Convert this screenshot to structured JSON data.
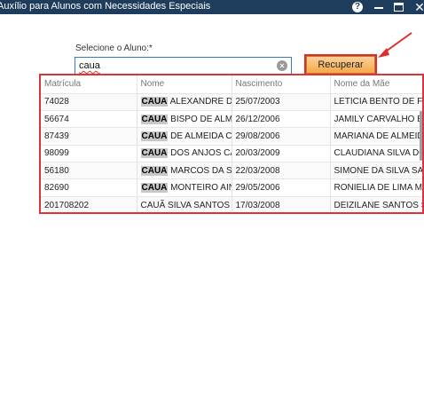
{
  "window": {
    "title": "Auxílio para Alunos com Necessidades Especiais",
    "help_glyph": "?",
    "close_glyph": "✕"
  },
  "form": {
    "label": "Selecione o Aluno:*",
    "search_value": "caua",
    "recover_label": "Recuperar"
  },
  "colors": {
    "titlebar": "#1e3c5c",
    "highlight_border": "#d9353a",
    "button": "#f5a94a"
  },
  "grid": {
    "columns": [
      "Matrícula",
      "Nome",
      "Nascimento",
      "Nome da Mãe"
    ],
    "rows": [
      {
        "matricula": "74028",
        "nome_hl": "CAUA",
        "nome_rest": " ALEXANDRE DE F",
        "nascimento": "25/07/2003",
        "mae": "LETICIA BENTO DE FREI"
      },
      {
        "matricula": "56674",
        "nome_hl": "CAUA",
        "nome_rest": " BISPO DE ALMEID",
        "nascimento": "26/12/2006",
        "mae": "JAMILY CARVALHO BISI"
      },
      {
        "matricula": "87439",
        "nome_hl": "CAUA",
        "nome_rest": " DE ALMEIDA CAF",
        "nascimento": "29/08/2006",
        "mae": "MARIANA DE ALMEIDA"
      },
      {
        "matricula": "98099",
        "nome_hl": "CAUA",
        "nome_rest": " DOS ANJOS CAM",
        "nascimento": "20/03/2009",
        "mae": "CLAUDIANA SILVA DOS"
      },
      {
        "matricula": "56180",
        "nome_hl": "CAUA",
        "nome_rest": " MARCOS DA SILV",
        "nascimento": "22/03/2008",
        "mae": "SIMONE DA SILVA SAN"
      },
      {
        "matricula": "82690",
        "nome_hl": "CAUA",
        "nome_rest": " MONTEIRO AINS",
        "nascimento": "29/05/2006",
        "mae": "RONIELIA DE LIMA MO"
      },
      {
        "matricula": "201708202",
        "nome_hl": "",
        "nome_rest": "CAUÃ SILVA SANTOS",
        "nascimento": "17/03/2008",
        "mae": "DEIZILANE SANTOS SIL"
      }
    ]
  }
}
